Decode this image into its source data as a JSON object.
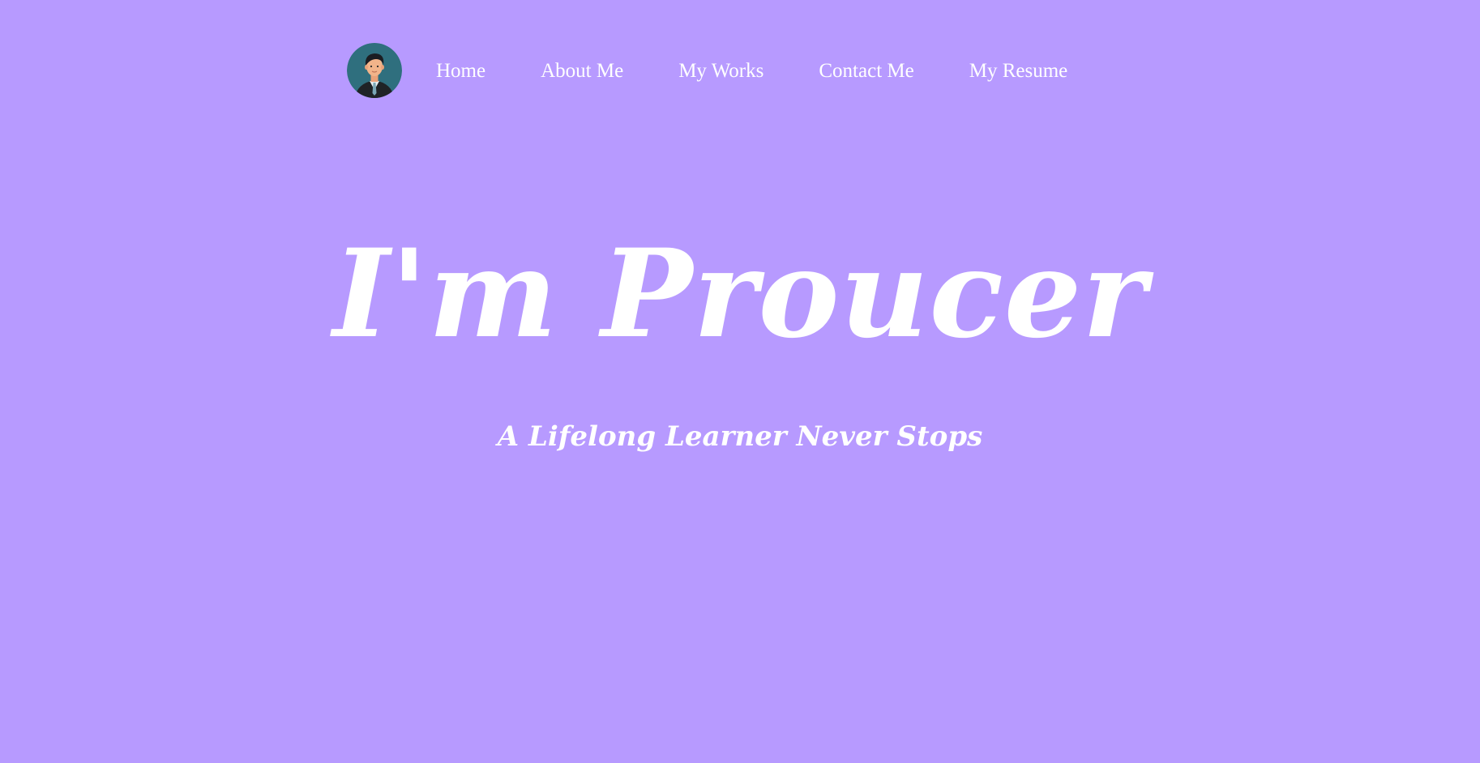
{
  "nav": {
    "avatar_icon": "person-in-suit-avatar-icon",
    "links": [
      {
        "label": "Home"
      },
      {
        "label": "About Me"
      },
      {
        "label": "My Works"
      },
      {
        "label": "Contact Me"
      },
      {
        "label": "My Resume"
      }
    ]
  },
  "hero": {
    "title": "I'm Proucer",
    "subtitle": "A Lifelong Learner Never Stops"
  },
  "colors": {
    "background": "#b79aff",
    "text": "#ffffff",
    "avatar_bg": "#2f6f7e"
  }
}
